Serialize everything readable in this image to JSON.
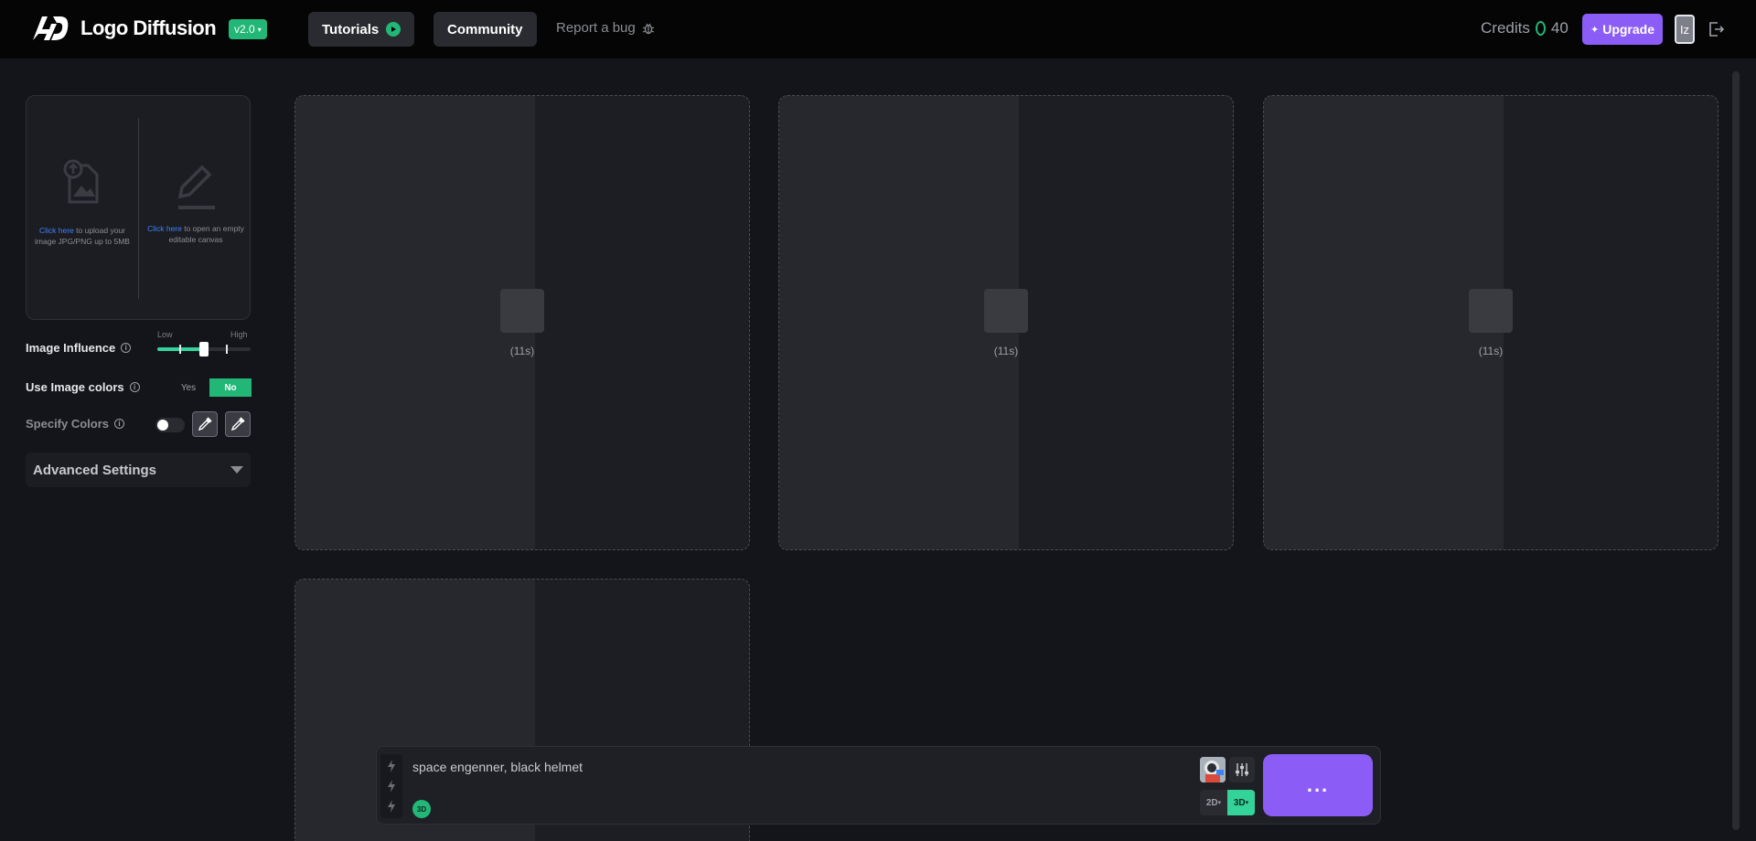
{
  "header": {
    "brand": "Logo Diffusion",
    "version": "v2.0",
    "tutorials_label": "Tutorials",
    "community_label": "Community",
    "report_bug_label": "Report a bug",
    "credits_label": "Credits",
    "credits_value": "40",
    "upgrade_label": "Upgrade",
    "avatar_initials": "Iz"
  },
  "sidebar": {
    "upload": {
      "left_link": "Click here",
      "left_text": " to upload your image JPG/PNG up to 5MB",
      "right_link": "Click here",
      "right_text": " to open an empty editable canvas"
    },
    "image_influence": {
      "label": "Image Influence",
      "low": "Low",
      "high": "High",
      "level": 0.5
    },
    "use_image_colors": {
      "label": "Use Image colors",
      "yes": "Yes",
      "no": "No",
      "selected": "No"
    },
    "specify_colors": {
      "label": "Specify Colors",
      "enabled": false
    },
    "advanced_settings_label": "Advanced Settings"
  },
  "cards": [
    {
      "time": "(11s)"
    },
    {
      "time": "(11s)"
    },
    {
      "time": "(11s)"
    },
    {
      "time": ""
    }
  ],
  "prompt": {
    "text": "space engenner, black helmet",
    "style_tag": "3D",
    "mode_2d": "2D",
    "mode_3d": "3D",
    "generate_label": "..."
  },
  "colors": {
    "accent": "#8b5cf6",
    "green": "#22b776",
    "background": "#14151a"
  }
}
